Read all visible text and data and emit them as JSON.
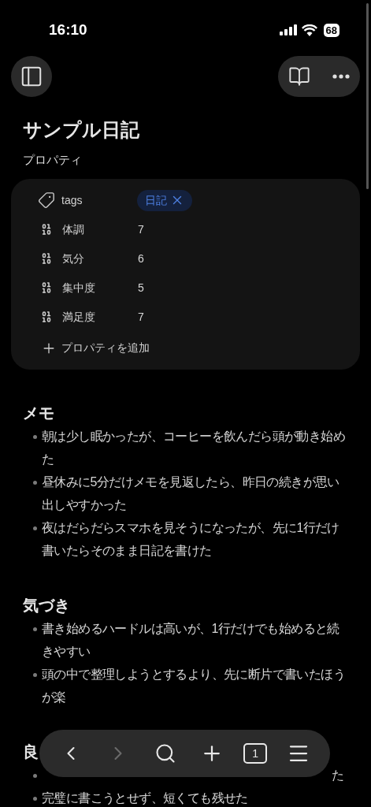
{
  "status_bar": {
    "time": "16:10",
    "battery": "68"
  },
  "page": {
    "title": "サンプル日記",
    "properties_label": "プロパティ"
  },
  "properties": [
    {
      "kind": "tags",
      "name": "tags",
      "tags": [
        "日記"
      ]
    },
    {
      "kind": "number",
      "name": "体調",
      "value": "7"
    },
    {
      "kind": "number",
      "name": "気分",
      "value": "6"
    },
    {
      "kind": "number",
      "name": "集中度",
      "value": "5"
    },
    {
      "kind": "number",
      "name": "満足度",
      "value": "7"
    }
  ],
  "add_property": "プロパティを追加",
  "sections": [
    {
      "heading": "メモ",
      "items": [
        {
          "text": "朝は少し眠かったが、コーヒーを飲んだら頭が動き始めた"
        },
        {
          "text": "昼休みに5分だけメモを見返したら、昨日の続きが思い出しやすかった"
        },
        {
          "text": "夜はだらだらスマホを見そうになったが、先に1行だけ書いたらそのまま日記を書けた"
        }
      ]
    },
    {
      "heading": "気づき",
      "items": [
        {
          "text": "書き始めるハードルは高いが、1行だけでも始めると続きやすい"
        },
        {
          "text": "頭の中で整理しようとするより、先に断片で書いたほうが楽"
        }
      ]
    },
    {
      "heading": "良",
      "items": [
        {
          "text": "た",
          "partial": true
        },
        {
          "text": "完璧に書こうとせず、短くても残せた"
        }
      ]
    }
  ],
  "toolbar": [
    {
      "kind": "back",
      "disabled": false
    },
    {
      "kind": "forward",
      "disabled": true
    },
    {
      "kind": "search",
      "disabled": false
    },
    {
      "kind": "add",
      "disabled": false
    },
    {
      "kind": "tabs",
      "label": "1",
      "disabled": false
    },
    {
      "kind": "menu",
      "disabled": false
    }
  ]
}
